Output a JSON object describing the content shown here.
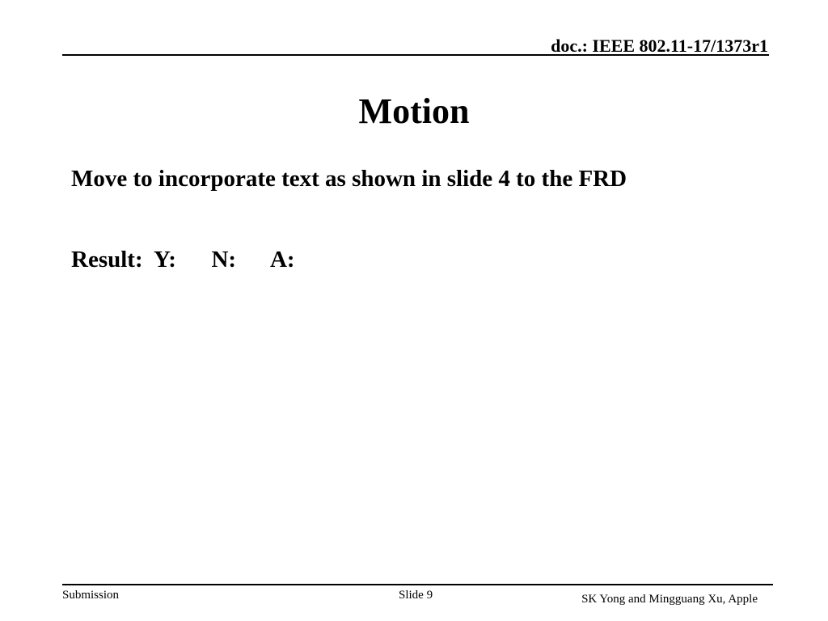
{
  "header": {
    "doc_id": "doc.: IEEE 802.11-17/1373r1"
  },
  "slide": {
    "title": "Motion",
    "body": [
      "Move to incorporate text as shown in slide 4 to the FRD",
      "Result:  Y:      N:      A:"
    ]
  },
  "footer": {
    "left": "Submission",
    "center": "Slide 9",
    "right": "SK Yong and Mingguang Xu, Apple"
  }
}
